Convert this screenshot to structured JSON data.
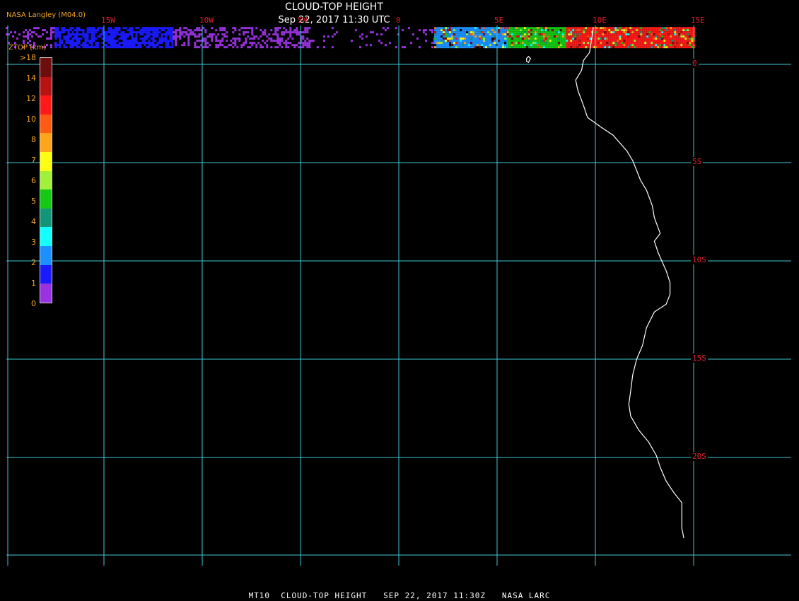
{
  "header": {
    "title": "CLOUD-TOP HEIGHT",
    "subtitle": "Sep 22, 2017 11:30 UTC",
    "provider": "NASA Langley (M04.0)"
  },
  "footer": {
    "text": "MT10  CLOUD-TOP HEIGHT   SEP 22, 2017 11:30Z   NASA LARC"
  },
  "colors": {
    "grid": "#3fc9d6",
    "coast": "#ffffff",
    "grid_label": "#e0202a",
    "legend_text": "#f5a623"
  },
  "map": {
    "projection": "equirectangular",
    "lon_range": [
      -20,
      15
    ],
    "lat_range": [
      -24,
      2
    ],
    "lon_ticks": [
      {
        "value": -15,
        "label": "15W"
      },
      {
        "value": -10,
        "label": "10W"
      },
      {
        "value": -5,
        "label": "5W"
      },
      {
        "value": 0,
        "label": "0"
      },
      {
        "value": 5,
        "label": "5E"
      },
      {
        "value": 10,
        "label": "10E"
      },
      {
        "value": 15,
        "label": "15E"
      }
    ],
    "lat_ticks": [
      {
        "value": 0,
        "label": "0"
      },
      {
        "value": -5,
        "label": "5S"
      },
      {
        "value": -10,
        "label": "10S"
      },
      {
        "value": -15,
        "label": "15S"
      },
      {
        "value": -20,
        "label": "20S"
      }
    ],
    "coastline": [
      [
        9.9,
        1.9
      ],
      [
        9.8,
        1.2
      ],
      [
        9.7,
        0.6
      ],
      [
        9.4,
        0.2
      ],
      [
        9.3,
        -0.3
      ],
      [
        9.0,
        -0.8
      ],
      [
        9.1,
        -1.3
      ],
      [
        9.4,
        -2.1
      ],
      [
        9.6,
        -2.7
      ],
      [
        10.3,
        -3.2
      ],
      [
        10.9,
        -3.6
      ],
      [
        11.6,
        -4.4
      ],
      [
        11.9,
        -4.9
      ],
      [
        12.3,
        -5.9
      ],
      [
        12.6,
        -6.4
      ],
      [
        12.9,
        -7.2
      ],
      [
        13.0,
        -7.8
      ],
      [
        13.3,
        -8.6
      ],
      [
        13.0,
        -9.0
      ],
      [
        13.2,
        -9.6
      ],
      [
        13.6,
        -10.5
      ],
      [
        13.8,
        -11.1
      ],
      [
        13.8,
        -11.7
      ],
      [
        13.6,
        -12.2
      ],
      [
        13.0,
        -12.6
      ],
      [
        12.6,
        -13.4
      ],
      [
        12.4,
        -14.3
      ],
      [
        12.1,
        -15.0
      ],
      [
        11.9,
        -15.8
      ],
      [
        11.8,
        -16.6
      ],
      [
        11.7,
        -17.3
      ],
      [
        11.8,
        -17.9
      ],
      [
        12.2,
        -18.6
      ],
      [
        12.7,
        -19.2
      ],
      [
        13.1,
        -19.9
      ],
      [
        13.3,
        -20.5
      ],
      [
        13.6,
        -21.2
      ],
      [
        14.0,
        -21.8
      ],
      [
        14.4,
        -22.3
      ],
      [
        14.4,
        -22.9
      ],
      [
        14.4,
        -23.6
      ],
      [
        14.5,
        -24.1
      ]
    ],
    "island": [
      [
        6.5,
        0.3
      ],
      [
        6.6,
        0.4
      ],
      [
        6.7,
        0.3
      ],
      [
        6.6,
        0.1
      ],
      [
        6.5,
        0.15
      ]
    ]
  },
  "legend": {
    "title": "ZTOP (km)",
    "colors": [
      "#6e0d0d",
      "#b81212",
      "#ff1a1a",
      "#ff5a14",
      "#ffa51a",
      "#ffff14",
      "#a0f03c",
      "#14c814",
      "#139678",
      "#14ffff",
      "#1c90ff",
      "#1a1aff",
      "#9932e0"
    ],
    "tick_labels": [
      ">18",
      "14",
      "12",
      "10",
      "8",
      "7",
      "6",
      "5",
      "4",
      "3",
      "2",
      "1",
      "0"
    ]
  },
  "cloud_strip": {
    "lon_range": [
      -20,
      15
    ],
    "lat_range": [
      0.9,
      1.9
    ],
    "segments": [
      {
        "from": -20,
        "to": -17.5,
        "color": "#9932e0",
        "density": 0.25
      },
      {
        "from": -17.5,
        "to": -11.5,
        "color": "#1a1aff",
        "density": 0.75
      },
      {
        "from": -11.5,
        "to": -4.5,
        "color": "#9932e0",
        "density": 0.45
      },
      {
        "from": -4.5,
        "to": 1.8,
        "color": "#9932e0",
        "density": 0.1
      },
      {
        "from": 1.8,
        "to": 5.5,
        "color": "#1c90ff",
        "density": 0.95
      },
      {
        "from": 5.5,
        "to": 8.5,
        "color": "#14c814",
        "density": 1.0
      },
      {
        "from": 8.5,
        "to": 15,
        "color": "#ff1a1a",
        "density": 1.0
      }
    ]
  }
}
